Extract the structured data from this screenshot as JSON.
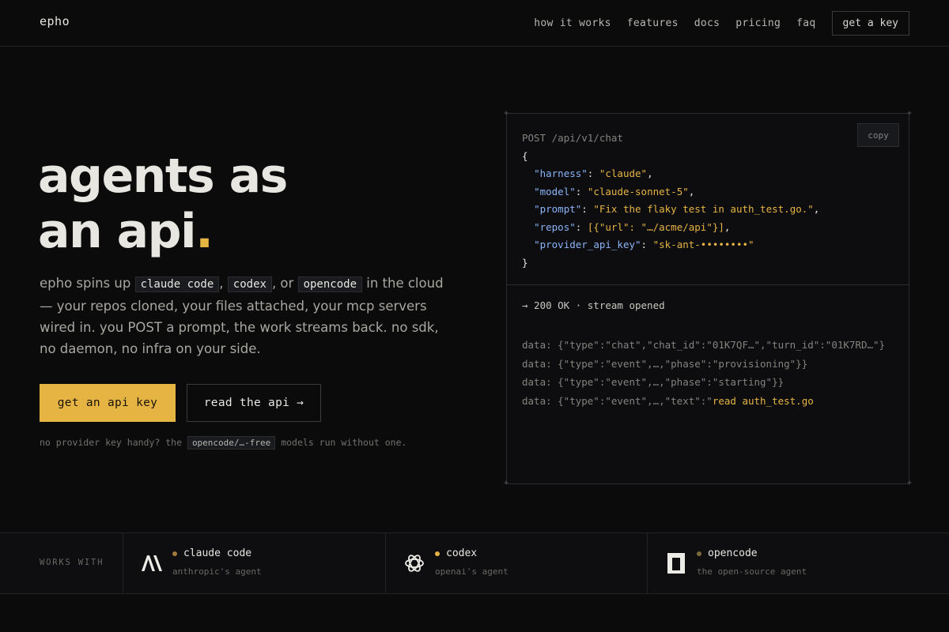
{
  "nav": {
    "logo": "epho",
    "links": [
      "how it works",
      "features",
      "docs",
      "pricing",
      "faq"
    ],
    "cta": "get a key"
  },
  "hero": {
    "title_line1": "agents as",
    "title_line2": "an api",
    "title_dot": ".",
    "desc": {
      "part1": "epho spins up ",
      "chip1": "claude code",
      "sep1": ", ",
      "chip2": "codex",
      "sep2": ", or ",
      "chip3": "opencode",
      "part2": " in the cloud — your repos cloned, your files attached, your mcp servers wired in. you POST a prompt, the work streams back. no sdk, no daemon, no infra on your side."
    },
    "primary_cta": "get an api key",
    "secondary_cta": "read the api →",
    "note": {
      "before": "no provider key handy? the ",
      "chip": "opencode/…-free",
      "after": " models run without one."
    }
  },
  "code_panel": {
    "copy_label": "copy",
    "request_line": "POST /api/v1/chat",
    "body": {
      "open": "{",
      "fields": [
        {
          "key": "\"harness\"",
          "value": "\"claude\"",
          "suffix": ","
        },
        {
          "key": "\"model\"",
          "value": "\"claude-sonnet-5\"",
          "suffix": ","
        },
        {
          "key": "\"prompt\"",
          "value": "\"Fix the flaky test in auth_test.go.\"",
          "suffix": ","
        },
        {
          "key": "\"repos\"",
          "value": "[{\"url\": \"…/acme/api\"}]",
          "suffix": ","
        },
        {
          "key": "\"provider_api_key\"",
          "value": "\"sk-ant-••••••••\"",
          "suffix": ""
        }
      ],
      "close": "}"
    },
    "response_status": "→ 200 OK · stream opened",
    "stream": [
      "data: {\"type\":\"chat\",\"chat_id\":\"01K7QF…\",\"turn_id\":\"01K7RD…\"}",
      "data: {\"type\":\"event\",…,\"phase\":\"provisioning\"}}",
      "data: {\"type\":\"event\",…,\"phase\":\"starting\"}}"
    ],
    "stream_last_prefix": "data: {\"type\":\"event\",…,\"text\":\"",
    "stream_last_text": "read auth_test.go"
  },
  "works_with": {
    "label": "WORKS WITH",
    "items": [
      {
        "name": "claude code",
        "sub": "anthropic's agent",
        "icon": "anthropic-icon",
        "dot_color": "#a07a3a"
      },
      {
        "name": "codex",
        "sub": "openai's agent",
        "icon": "openai-icon",
        "dot_color": "#e5b443"
      },
      {
        "name": "opencode",
        "sub": "the open-source agent",
        "icon": "opencode-icon",
        "dot_color": "#7d6a3a"
      }
    ]
  },
  "colors": {
    "accent": "#e5b443",
    "background": "#0b0b0c",
    "json_key": "#8ab4f8"
  }
}
